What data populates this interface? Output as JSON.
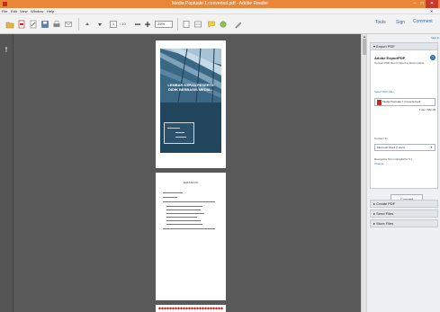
{
  "window": {
    "title": "Media Poptuale 1 converted.pdf - Adobe Reader"
  },
  "menu": [
    "File",
    "Edit",
    "View",
    "Window",
    "Help"
  ],
  "toolbar": {
    "page_current": "1",
    "page_total": "/ 10",
    "zoom": "25%",
    "tools_label": "Tools",
    "sign_label": "Sign",
    "comment_label": "Comment"
  },
  "document": {
    "cover_title": "LEMBAR KERJA PESERTA DIDIK BERBASIS MEDIA...",
    "page2_title": "DAFTAR ISI"
  },
  "panel": {
    "sign_in": "Sign In",
    "export_header": "Export PDF",
    "export_title": "Adobe ExportPDF",
    "export_desc": "Convert PDF files to Word or Excel online.",
    "select_file_label": "Select PDF File:",
    "file_name": "Media Poptuale 1 converted.pdf",
    "file_info": "1 file / 682 kB",
    "convert_to_label": "Convert To:",
    "convert_to_value": "Microsoft Word (*.docx)",
    "language_text": "Recognize Text in English(U.S.)",
    "change_link": "Change",
    "convert_button": "Convert",
    "sections": [
      "Create PDF",
      "Send Files",
      "Store Files"
    ]
  },
  "colors": {
    "titlebar": "#e8863a",
    "accent": "#2a6cb5",
    "doc_bg": "#595959",
    "cover": "#22465e"
  }
}
